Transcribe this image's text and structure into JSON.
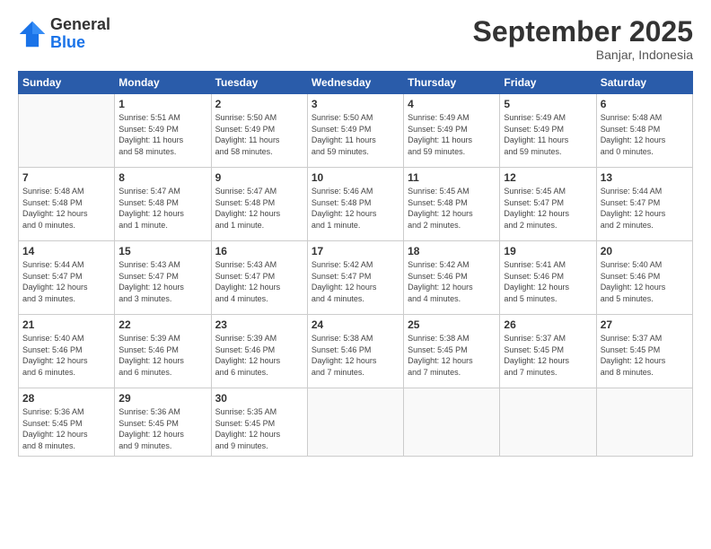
{
  "logo": {
    "general": "General",
    "blue": "Blue"
  },
  "header": {
    "title": "September 2025",
    "subtitle": "Banjar, Indonesia"
  },
  "days_of_week": [
    "Sunday",
    "Monday",
    "Tuesday",
    "Wednesday",
    "Thursday",
    "Friday",
    "Saturday"
  ],
  "weeks": [
    [
      {
        "day": "",
        "info": ""
      },
      {
        "day": "1",
        "info": "Sunrise: 5:51 AM\nSunset: 5:49 PM\nDaylight: 11 hours\nand 58 minutes."
      },
      {
        "day": "2",
        "info": "Sunrise: 5:50 AM\nSunset: 5:49 PM\nDaylight: 11 hours\nand 58 minutes."
      },
      {
        "day": "3",
        "info": "Sunrise: 5:50 AM\nSunset: 5:49 PM\nDaylight: 11 hours\nand 59 minutes."
      },
      {
        "day": "4",
        "info": "Sunrise: 5:49 AM\nSunset: 5:49 PM\nDaylight: 11 hours\nand 59 minutes."
      },
      {
        "day": "5",
        "info": "Sunrise: 5:49 AM\nSunset: 5:49 PM\nDaylight: 11 hours\nand 59 minutes."
      },
      {
        "day": "6",
        "info": "Sunrise: 5:48 AM\nSunset: 5:48 PM\nDaylight: 12 hours\nand 0 minutes."
      }
    ],
    [
      {
        "day": "7",
        "info": "Sunrise: 5:48 AM\nSunset: 5:48 PM\nDaylight: 12 hours\nand 0 minutes."
      },
      {
        "day": "8",
        "info": "Sunrise: 5:47 AM\nSunset: 5:48 PM\nDaylight: 12 hours\nand 1 minute."
      },
      {
        "day": "9",
        "info": "Sunrise: 5:47 AM\nSunset: 5:48 PM\nDaylight: 12 hours\nand 1 minute."
      },
      {
        "day": "10",
        "info": "Sunrise: 5:46 AM\nSunset: 5:48 PM\nDaylight: 12 hours\nand 1 minute."
      },
      {
        "day": "11",
        "info": "Sunrise: 5:45 AM\nSunset: 5:48 PM\nDaylight: 12 hours\nand 2 minutes."
      },
      {
        "day": "12",
        "info": "Sunrise: 5:45 AM\nSunset: 5:47 PM\nDaylight: 12 hours\nand 2 minutes."
      },
      {
        "day": "13",
        "info": "Sunrise: 5:44 AM\nSunset: 5:47 PM\nDaylight: 12 hours\nand 2 minutes."
      }
    ],
    [
      {
        "day": "14",
        "info": "Sunrise: 5:44 AM\nSunset: 5:47 PM\nDaylight: 12 hours\nand 3 minutes."
      },
      {
        "day": "15",
        "info": "Sunrise: 5:43 AM\nSunset: 5:47 PM\nDaylight: 12 hours\nand 3 minutes."
      },
      {
        "day": "16",
        "info": "Sunrise: 5:43 AM\nSunset: 5:47 PM\nDaylight: 12 hours\nand 4 minutes."
      },
      {
        "day": "17",
        "info": "Sunrise: 5:42 AM\nSunset: 5:47 PM\nDaylight: 12 hours\nand 4 minutes."
      },
      {
        "day": "18",
        "info": "Sunrise: 5:42 AM\nSunset: 5:46 PM\nDaylight: 12 hours\nand 4 minutes."
      },
      {
        "day": "19",
        "info": "Sunrise: 5:41 AM\nSunset: 5:46 PM\nDaylight: 12 hours\nand 5 minutes."
      },
      {
        "day": "20",
        "info": "Sunrise: 5:40 AM\nSunset: 5:46 PM\nDaylight: 12 hours\nand 5 minutes."
      }
    ],
    [
      {
        "day": "21",
        "info": "Sunrise: 5:40 AM\nSunset: 5:46 PM\nDaylight: 12 hours\nand 6 minutes."
      },
      {
        "day": "22",
        "info": "Sunrise: 5:39 AM\nSunset: 5:46 PM\nDaylight: 12 hours\nand 6 minutes."
      },
      {
        "day": "23",
        "info": "Sunrise: 5:39 AM\nSunset: 5:46 PM\nDaylight: 12 hours\nand 6 minutes."
      },
      {
        "day": "24",
        "info": "Sunrise: 5:38 AM\nSunset: 5:46 PM\nDaylight: 12 hours\nand 7 minutes."
      },
      {
        "day": "25",
        "info": "Sunrise: 5:38 AM\nSunset: 5:45 PM\nDaylight: 12 hours\nand 7 minutes."
      },
      {
        "day": "26",
        "info": "Sunrise: 5:37 AM\nSunset: 5:45 PM\nDaylight: 12 hours\nand 7 minutes."
      },
      {
        "day": "27",
        "info": "Sunrise: 5:37 AM\nSunset: 5:45 PM\nDaylight: 12 hours\nand 8 minutes."
      }
    ],
    [
      {
        "day": "28",
        "info": "Sunrise: 5:36 AM\nSunset: 5:45 PM\nDaylight: 12 hours\nand 8 minutes."
      },
      {
        "day": "29",
        "info": "Sunrise: 5:36 AM\nSunset: 5:45 PM\nDaylight: 12 hours\nand 9 minutes."
      },
      {
        "day": "30",
        "info": "Sunrise: 5:35 AM\nSunset: 5:45 PM\nDaylight: 12 hours\nand 9 minutes."
      },
      {
        "day": "",
        "info": ""
      },
      {
        "day": "",
        "info": ""
      },
      {
        "day": "",
        "info": ""
      },
      {
        "day": "",
        "info": ""
      }
    ]
  ]
}
